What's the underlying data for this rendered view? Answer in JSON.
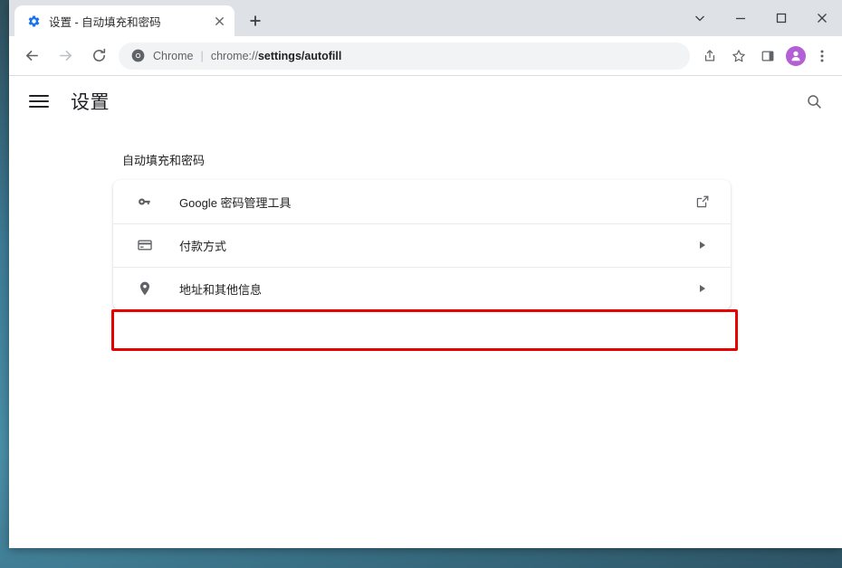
{
  "window": {
    "controls": [
      {
        "name": "tab-search",
        "glyph": "chevron-down"
      },
      {
        "name": "minimize",
        "glyph": "minus"
      },
      {
        "name": "maximize",
        "glyph": "square"
      },
      {
        "name": "close",
        "glyph": "times"
      }
    ]
  },
  "tabstrip": {
    "tabs": [
      {
        "title": "设置 - 自动填充和密码",
        "favicon": "settings-gear-icon",
        "favicon_color": "#1a73e8",
        "active": true,
        "close_label": "×"
      }
    ],
    "new_tab_label": "+",
    "background": "#dee1e6"
  },
  "toolbar": {
    "back": {
      "name": "back-button",
      "enabled": true
    },
    "forward": {
      "name": "forward-button",
      "enabled": false
    },
    "reload": {
      "name": "reload-button",
      "enabled": true
    },
    "omnibox": {
      "security_icon": "chrome-logo-icon",
      "chip_label": "Chrome",
      "separator": "|",
      "url_prefix": "chrome://",
      "url_bold": "settings/autofill",
      "full_url": "chrome://settings/autofill"
    },
    "actions": [
      {
        "name": "share-icon",
        "label": "分享"
      },
      {
        "name": "bookmark-star-icon",
        "label": "收藏"
      },
      {
        "name": "side-panel-icon",
        "label": "侧边栏"
      }
    ],
    "avatar": {
      "name": "profile-avatar",
      "color": "#b35fd6",
      "glyph": "person-icon"
    },
    "menu": {
      "name": "chrome-menu-button",
      "label": "⋮"
    }
  },
  "settings": {
    "menu_label": "主菜单",
    "title": "设置",
    "search_label": "在设置中搜索",
    "section": {
      "heading": "自动填充和密码",
      "rows": [
        {
          "icon": "key-icon",
          "label": "Google 密码管理工具",
          "action": "open-in-new-icon",
          "highlighted": false
        },
        {
          "icon": "credit-card-icon",
          "label": "付款方式",
          "action": "chevron-right-icon",
          "highlighted": true
        },
        {
          "icon": "location-pin-icon",
          "label": "地址和其他信息",
          "action": "chevron-right-icon",
          "highlighted": false
        }
      ]
    }
  },
  "annotation": {
    "highlight_color": "#e60000",
    "target_row_label": "付款方式"
  }
}
